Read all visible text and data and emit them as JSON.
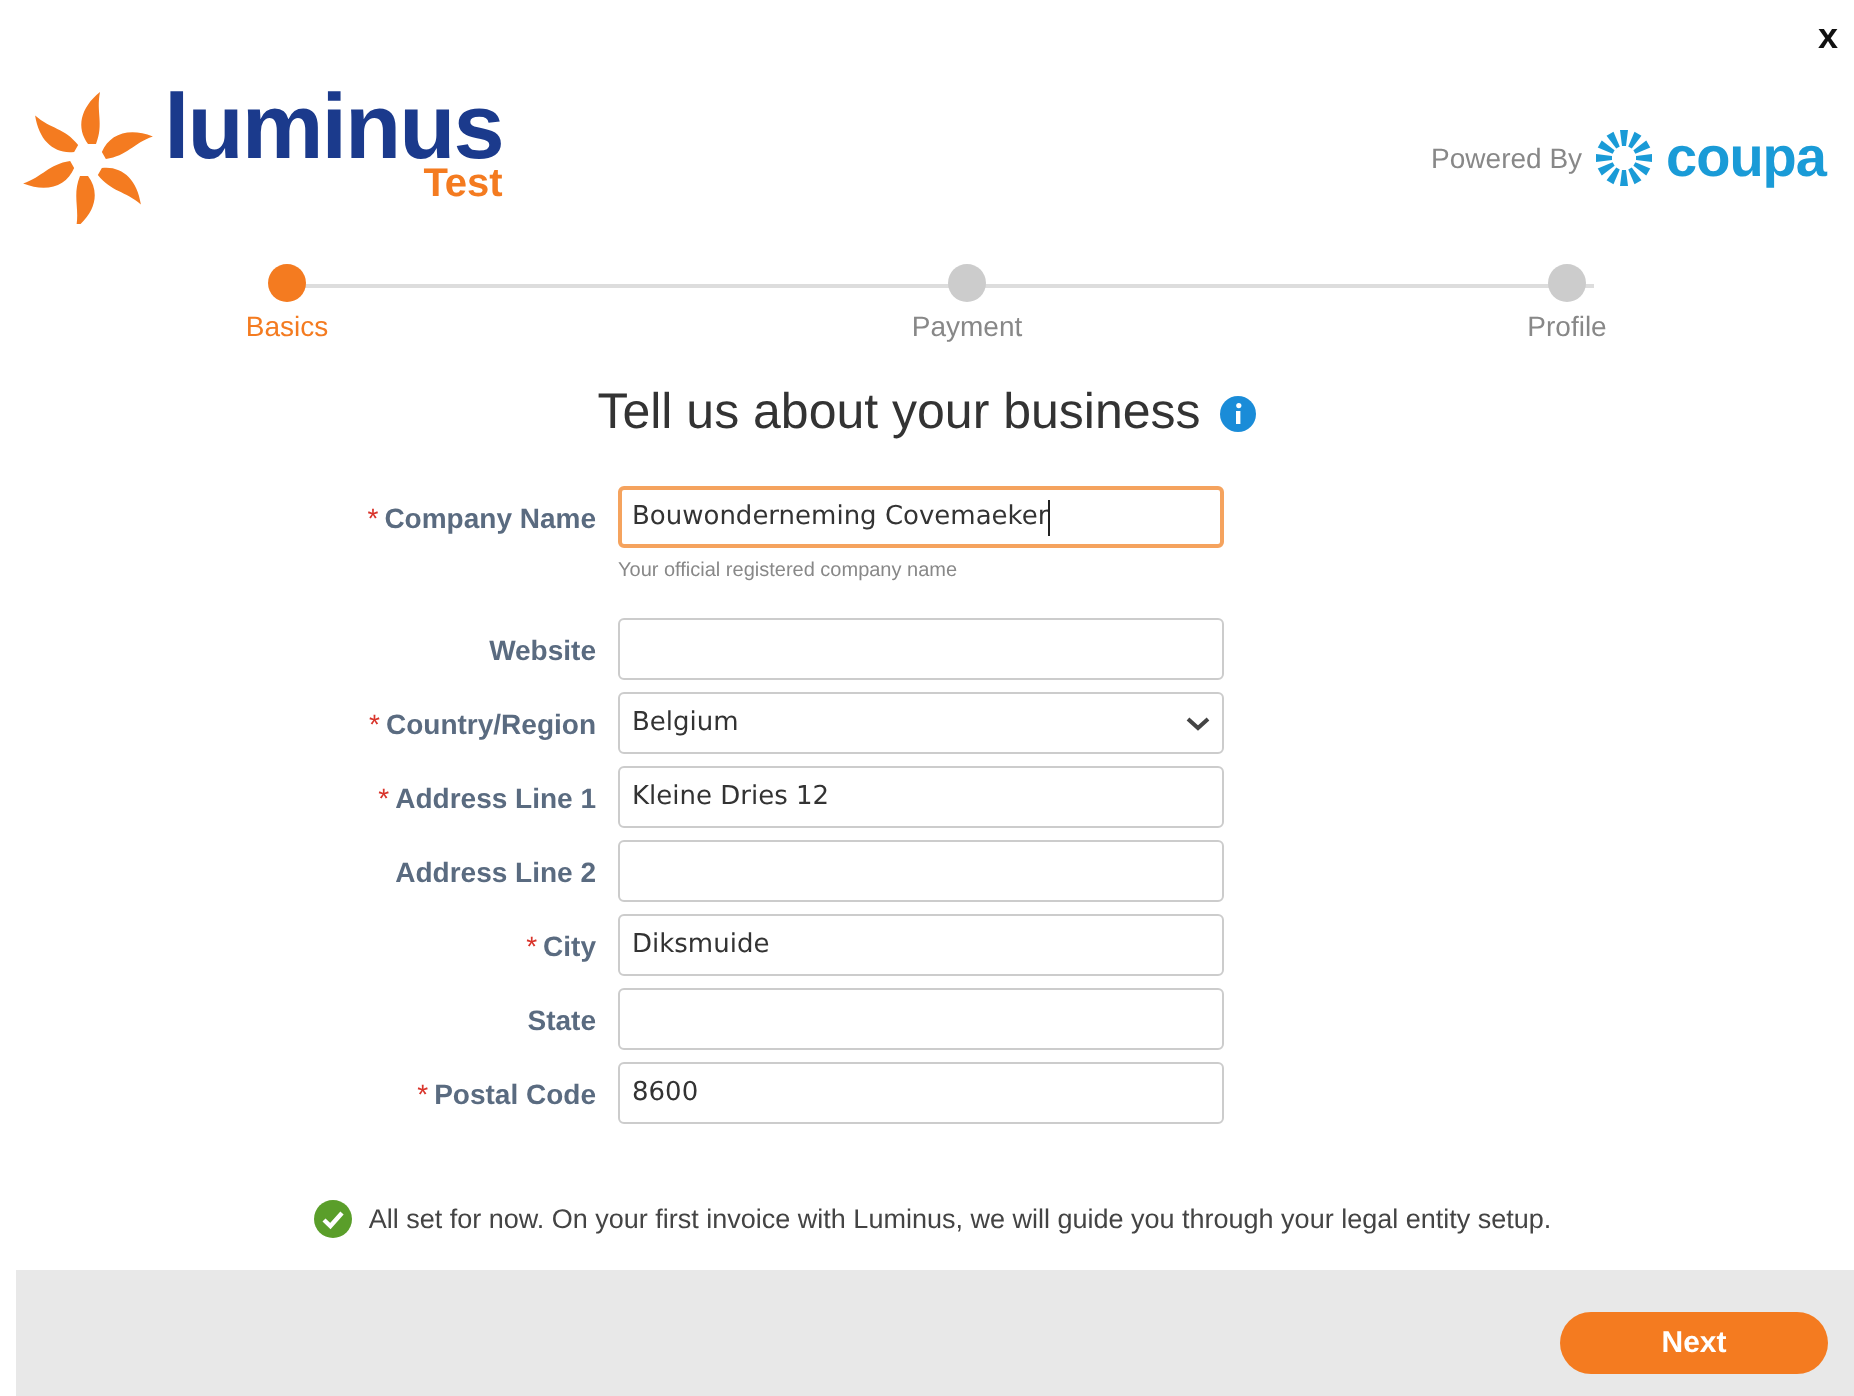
{
  "close": "x",
  "logo": {
    "name": "luminus",
    "tag": "Test"
  },
  "powered_by": {
    "label": "Powered By",
    "brand": "coupa"
  },
  "steps": [
    {
      "label": "Basics",
      "selected": true
    },
    {
      "label": "Payment",
      "selected": false
    },
    {
      "label": "Profile",
      "selected": false
    }
  ],
  "title": "Tell us about your business",
  "fields": [
    {
      "kind": "text",
      "label": "Company Name",
      "required": true,
      "focused": true,
      "value": "Bouwonderneming Covemaeker",
      "hint": "Your official registered company name"
    },
    {
      "kind": "text",
      "label": "Website",
      "required": false,
      "focused": false
    },
    {
      "kind": "select",
      "label": "Country/Region",
      "required": true,
      "focused": false,
      "value": "Belgium"
    },
    {
      "kind": "text",
      "label": "Address Line 1",
      "required": true,
      "focused": false,
      "value": "Kleine Dries 12"
    },
    {
      "kind": "text",
      "label": "Address Line 2",
      "required": false,
      "focused": false
    },
    {
      "kind": "text",
      "label": "City",
      "required": true,
      "focused": false,
      "value": "Diksmuide"
    },
    {
      "kind": "text",
      "label": "State",
      "required": false,
      "focused": false
    },
    {
      "kind": "text",
      "label": "Postal Code",
      "required": true,
      "focused": false,
      "value": "8600"
    }
  ],
  "required_mark": "*",
  "notice": "All set for now. On your first invoice with Luminus, we will guide you through your legal entity setup.",
  "next_button": "Next"
}
